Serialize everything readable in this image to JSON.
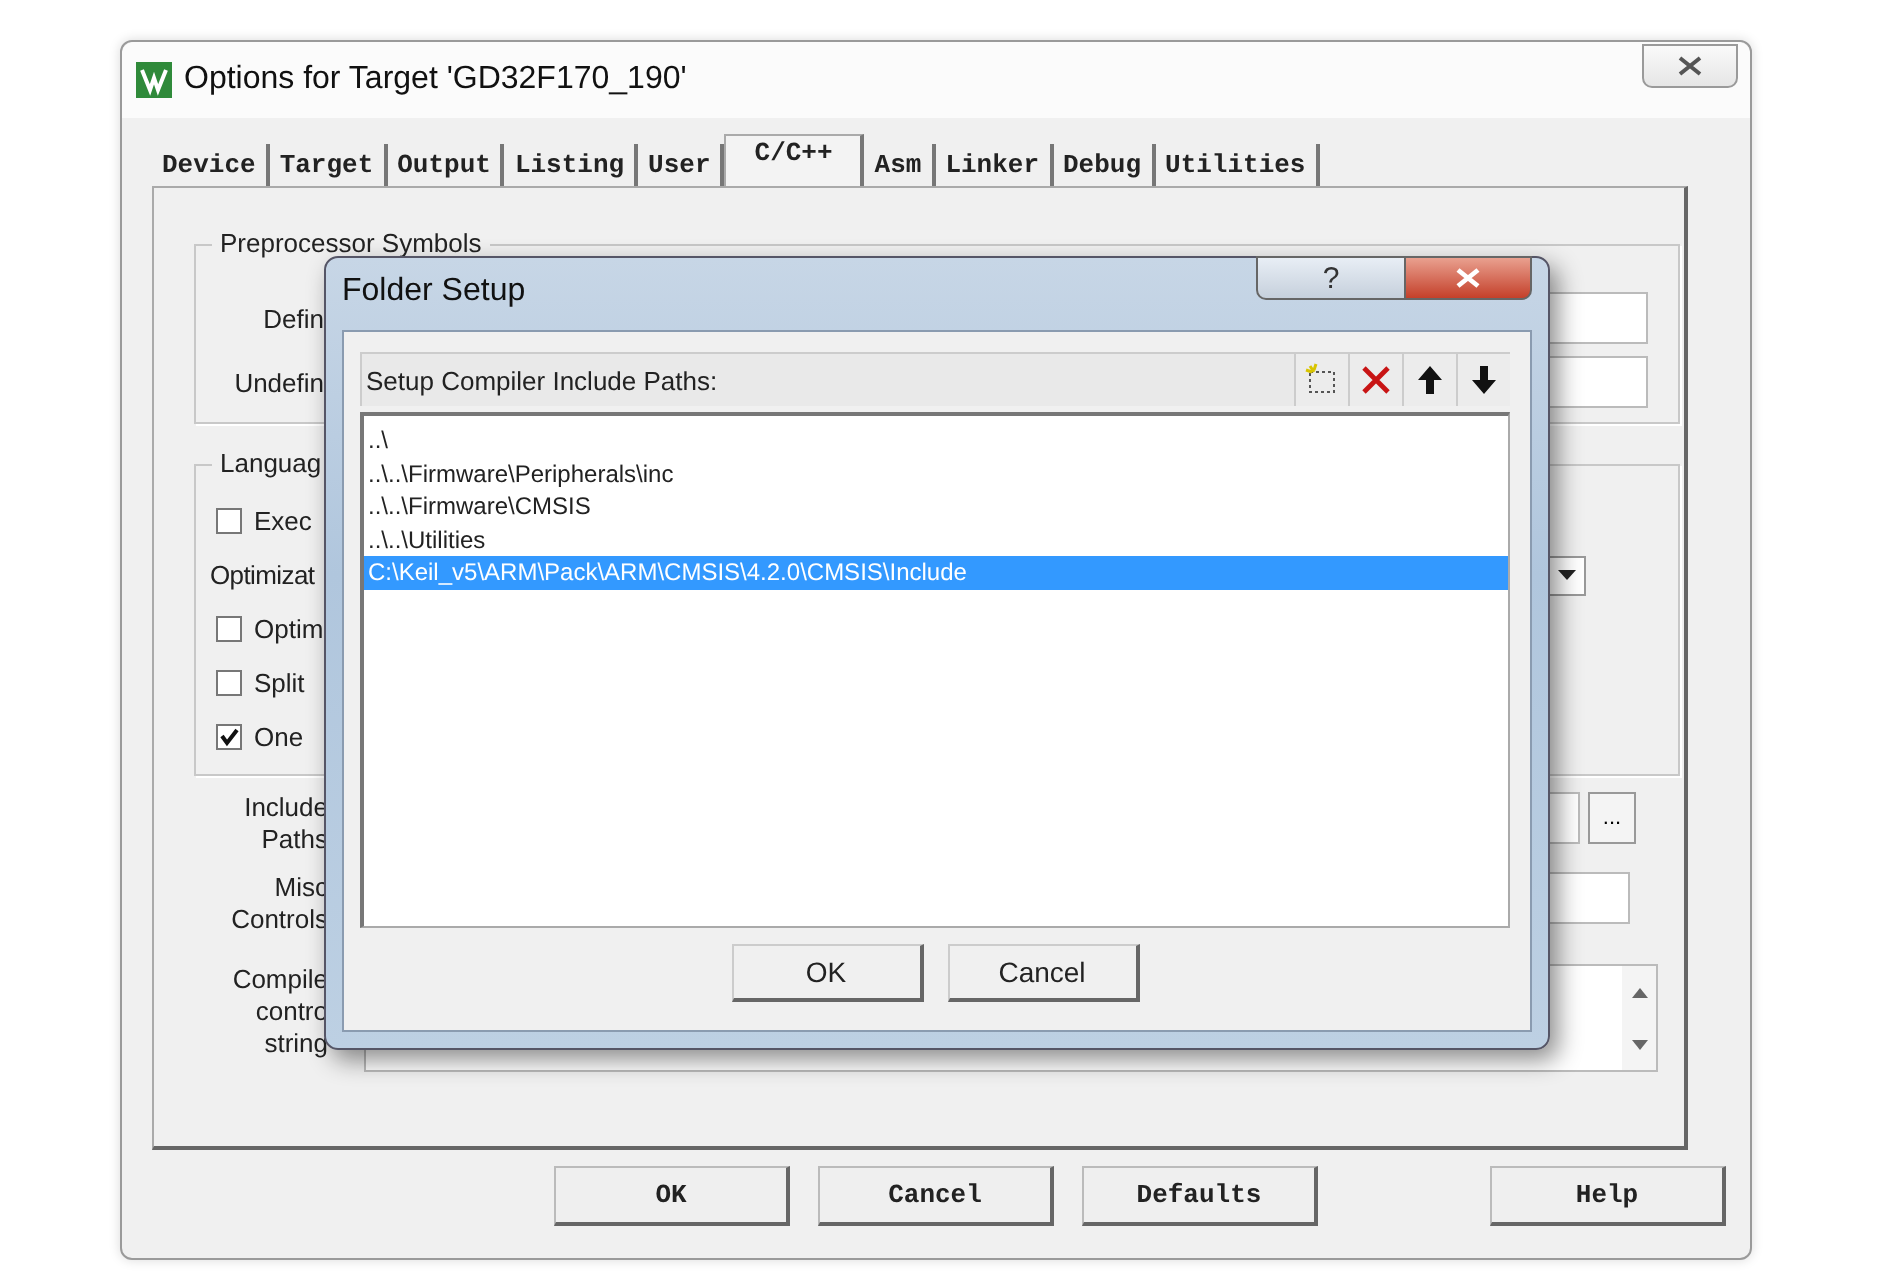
{
  "window": {
    "title": "Options for Target 'GD32F170_190'"
  },
  "tabs": [
    {
      "label": "Device",
      "selected": false
    },
    {
      "label": "Target",
      "selected": false
    },
    {
      "label": "Output",
      "selected": false
    },
    {
      "label": "Listing",
      "selected": false
    },
    {
      "label": "User",
      "selected": false
    },
    {
      "label": "C/C++",
      "selected": true
    },
    {
      "label": "Asm",
      "selected": false
    },
    {
      "label": "Linker",
      "selected": false
    },
    {
      "label": "Debug",
      "selected": false
    },
    {
      "label": "Utilities",
      "selected": false
    }
  ],
  "preprocessor": {
    "title": "Preprocessor Symbols",
    "rows": [
      "Defin",
      "Undefin"
    ]
  },
  "language": {
    "title": "Languag",
    "options": [
      {
        "kind": "checkbox",
        "label": "Exec",
        "checked": false
      },
      {
        "kind": "dropdown",
        "label": "Optimizat"
      },
      {
        "kind": "checkbox",
        "label": "Optim",
        "checked": false
      },
      {
        "kind": "checkbox",
        "label": "Split",
        "checked": false
      },
      {
        "kind": "checkbox",
        "label": "One",
        "checked": true
      }
    ]
  },
  "include_paths": {
    "label": "Include Paths",
    "browse": "..."
  },
  "misc_controls": {
    "label": "Misc Controls"
  },
  "compiler_string": {
    "label": "Compile contro string"
  },
  "buttons": [
    "OK",
    "Cancel",
    "Defaults",
    "Help"
  ],
  "folder_setup": {
    "title": "Folder Setup",
    "help": "?",
    "header": "Setup Compiler Include Paths:",
    "paths": [
      {
        "text": "..\\",
        "selected": false
      },
      {
        "text": "..\\..\\Firmware\\Peripherals\\inc",
        "selected": false
      },
      {
        "text": "..\\..\\Firmware\\CMSIS",
        "selected": false
      },
      {
        "text": "..\\..\\Utilities",
        "selected": false
      },
      {
        "text": "C:\\Keil_v5\\ARM\\Pack\\ARM\\CMSIS\\4.2.0\\CMSIS\\Include",
        "selected": true
      }
    ],
    "buttons": [
      "OK",
      "Cancel"
    ]
  }
}
